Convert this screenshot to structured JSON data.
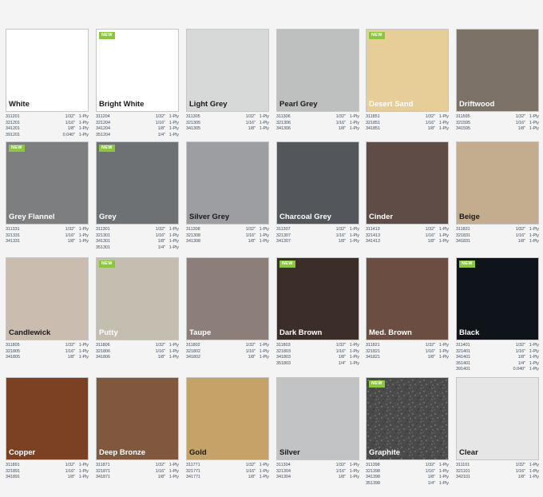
{
  "products": [
    {
      "name": "White",
      "color": "#ffffff",
      "text": "dark",
      "new": false,
      "specs": [
        [
          "311201",
          "1/32\"",
          "1-Ply"
        ],
        [
          "321201",
          "1/16\"",
          "1-Ply"
        ],
        [
          "341201",
          "1/8\"",
          "1-Ply"
        ],
        [
          "391201",
          "0.040\"",
          "1-Ply"
        ]
      ]
    },
    {
      "name": "Bright White",
      "color": "#ffffff",
      "text": "dark",
      "new": true,
      "specs": [
        [
          "311204",
          "1/32\"",
          "1-Ply"
        ],
        [
          "321204",
          "1/16\"",
          "1-Ply"
        ],
        [
          "341204",
          "1/8\"",
          "1-Ply"
        ],
        [
          "351204",
          "1/4\"",
          "1-Ply"
        ]
      ]
    },
    {
      "name": "Light Grey",
      "color": "#d7d8d8",
      "text": "dark",
      "new": false,
      "specs": [
        [
          "311305",
          "1/32\"",
          "1-Ply"
        ],
        [
          "321305",
          "1/16\"",
          "1-Ply"
        ],
        [
          "341305",
          "1/8\"",
          "1-Ply"
        ]
      ]
    },
    {
      "name": "Pearl Grey",
      "color": "#bebfbf",
      "text": "dark",
      "new": false,
      "specs": [
        [
          "311306",
          "1/32\"",
          "1-Ply"
        ],
        [
          "321306",
          "1/16\"",
          "1-Ply"
        ],
        [
          "341306",
          "1/8\"",
          "1-Ply"
        ]
      ]
    },
    {
      "name": "Desert Sand",
      "color": "#e7cd97",
      "text": "light",
      "new": true,
      "specs": [
        [
          "311851",
          "1/32\"",
          "1-Ply"
        ],
        [
          "321851",
          "1/16\"",
          "1-Ply"
        ],
        [
          "341851",
          "1/8\"",
          "1-Ply"
        ]
      ]
    },
    {
      "name": "Driftwood",
      "color": "#7c7267",
      "text": "light",
      "new": false,
      "specs": [
        [
          "311595",
          "1/32\"",
          "1-Ply"
        ],
        [
          "321595",
          "1/16\"",
          "1-Ply"
        ],
        [
          "341595",
          "1/8\"",
          "1-Ply"
        ]
      ]
    },
    {
      "name": "Grey Flannel",
      "color": "#7d7e80",
      "text": "light",
      "new": true,
      "specs": [
        [
          "311331",
          "1/32\"",
          "1-Ply"
        ],
        [
          "321331",
          "1/16\"",
          "1-Ply"
        ],
        [
          "341331",
          "1/8\"",
          "1-Ply"
        ]
      ]
    },
    {
      "name": "Grey",
      "color": "#6e7174",
      "text": "light",
      "new": true,
      "specs": [
        [
          "311301",
          "1/32\"",
          "1-Ply"
        ],
        [
          "321301",
          "1/16\"",
          "1-Ply"
        ],
        [
          "341301",
          "1/8\"",
          "1-Ply"
        ],
        [
          "351301",
          "1/4\"",
          "1-Ply"
        ]
      ]
    },
    {
      "name": "Silver Grey",
      "color": "#9c9ea1",
      "text": "dark",
      "new": false,
      "specs": [
        [
          "311308",
          "1/32\"",
          "1-Ply"
        ],
        [
          "321308",
          "1/16\"",
          "1-Ply"
        ],
        [
          "341308",
          "1/8\"",
          "1-Ply"
        ]
      ]
    },
    {
      "name": "Charcoal Grey",
      "color": "#53575b",
      "text": "light",
      "new": false,
      "specs": [
        [
          "311307",
          "1/32\"",
          "1-Ply"
        ],
        [
          "321307",
          "1/16\"",
          "1-Ply"
        ],
        [
          "341307",
          "1/8\"",
          "1-Ply"
        ]
      ]
    },
    {
      "name": "Cinder",
      "color": "#5f4c47",
      "text": "light",
      "new": false,
      "specs": [
        [
          "311413",
          "1/32\"",
          "1-Ply"
        ],
        [
          "321413",
          "1/16\"",
          "1-Ply"
        ],
        [
          "341413",
          "1/8\"",
          "1-Ply"
        ]
      ]
    },
    {
      "name": "Beige",
      "color": "#c4ad8e",
      "text": "dark",
      "new": false,
      "specs": [
        [
          "311831",
          "1/32\"",
          "1-Ply"
        ],
        [
          "321831",
          "1/16\"",
          "1-Ply"
        ],
        [
          "341831",
          "1/8\"",
          "1-Ply"
        ]
      ]
    },
    {
      "name": "Candlewick",
      "color": "#cabcae",
      "text": "dark",
      "new": false,
      "specs": [
        [
          "311805",
          "1/32\"",
          "1-Ply"
        ],
        [
          "321805",
          "1/16\"",
          "1-Ply"
        ],
        [
          "341805",
          "1/8\"",
          "1-Ply"
        ]
      ]
    },
    {
      "name": "Putty",
      "color": "#c3beb0",
      "text": "light",
      "new": true,
      "specs": [
        [
          "311806",
          "1/32\"",
          "1-Ply"
        ],
        [
          "321806",
          "1/16\"",
          "1-Ply"
        ],
        [
          "341806",
          "1/8\"",
          "1-Ply"
        ]
      ]
    },
    {
      "name": "Taupe",
      "color": "#8c7e78",
      "text": "light",
      "new": false,
      "specs": [
        [
          "311802",
          "1/32\"",
          "1-Ply"
        ],
        [
          "321802",
          "1/16\"",
          "1-Ply"
        ],
        [
          "341802",
          "1/8\"",
          "1-Ply"
        ]
      ]
    },
    {
      "name": "Dark Brown",
      "color": "#3b2d27",
      "text": "light",
      "new": true,
      "specs": [
        [
          "311803",
          "1/32\"",
          "1-Ply"
        ],
        [
          "321803",
          "1/16\"",
          "1-Ply"
        ],
        [
          "341803",
          "1/8\"",
          "1-Ply"
        ],
        [
          "351803",
          "1/4\"",
          "1-Ply"
        ]
      ]
    },
    {
      "name": "Med. Brown",
      "color": "#6b4d41",
      "text": "light",
      "new": false,
      "specs": [
        [
          "311821",
          "1/32\"",
          "1-Ply"
        ],
        [
          "321821",
          "1/16\"",
          "1-Ply"
        ],
        [
          "341821",
          "1/8\"",
          "1-Ply"
        ]
      ]
    },
    {
      "name": "Black",
      "color": "#0f141a",
      "text": "light",
      "new": true,
      "specs": [
        [
          "311401",
          "1/32\"",
          "1-Ply"
        ],
        [
          "321401",
          "1/16\"",
          "1-Ply"
        ],
        [
          "341401",
          "1/8\"",
          "1-Ply"
        ],
        [
          "351401",
          "1/4\"",
          "1-Ply"
        ],
        [
          "391401",
          "0.040\"",
          "1-Ply"
        ]
      ]
    },
    {
      "name": "Copper",
      "color": "#7b4122",
      "text": "light",
      "new": false,
      "specs": [
        [
          "311891",
          "1/32\"",
          "1-Ply"
        ],
        [
          "321891",
          "1/16\"",
          "1-Ply"
        ],
        [
          "341891",
          "1/8\"",
          "1-Ply"
        ]
      ]
    },
    {
      "name": "Deep Bronze",
      "color": "#80583e",
      "text": "light",
      "new": false,
      "specs": [
        [
          "311871",
          "1/32\"",
          "1-Ply"
        ],
        [
          "321871",
          "1/16\"",
          "1-Ply"
        ],
        [
          "341871",
          "1/8\"",
          "1-Ply"
        ]
      ]
    },
    {
      "name": "Gold",
      "color": "#c4a268",
      "text": "dark",
      "new": false,
      "specs": [
        [
          "311771",
          "1/32\"",
          "1-Ply"
        ],
        [
          "321771",
          "1/16\"",
          "1-Ply"
        ],
        [
          "341771",
          "1/8\"",
          "1-Ply"
        ]
      ]
    },
    {
      "name": "Silver",
      "color": "#c2c3c5",
      "text": "dark",
      "new": false,
      "specs": [
        [
          "311304",
          "1/32\"",
          "1-Ply"
        ],
        [
          "321304",
          "1/16\"",
          "1-Ply"
        ],
        [
          "341304",
          "1/8\"",
          "1-Ply"
        ]
      ]
    },
    {
      "name": "Graphite",
      "color": "#4b4b4b",
      "text": "light",
      "new": true,
      "texture": "speckled",
      "specs": [
        [
          "311398",
          "1/32\"",
          "1-Ply"
        ],
        [
          "321398",
          "1/16\"",
          "1-Ply"
        ],
        [
          "341398",
          "1/8\"",
          "1-Ply"
        ],
        [
          "351398",
          "1/4\"",
          "1-Ply"
        ]
      ]
    },
    {
      "name": "Clear",
      "color": "#e6e6e6",
      "text": "dark",
      "new": false,
      "specs": [
        [
          "311101",
          "1/32\"",
          "1-Ply"
        ],
        [
          "321101",
          "1/16\"",
          "1-Ply"
        ],
        [
          "342101",
          "1/8\"",
          "1-Ply"
        ]
      ]
    }
  ],
  "badge_label": "NEW"
}
